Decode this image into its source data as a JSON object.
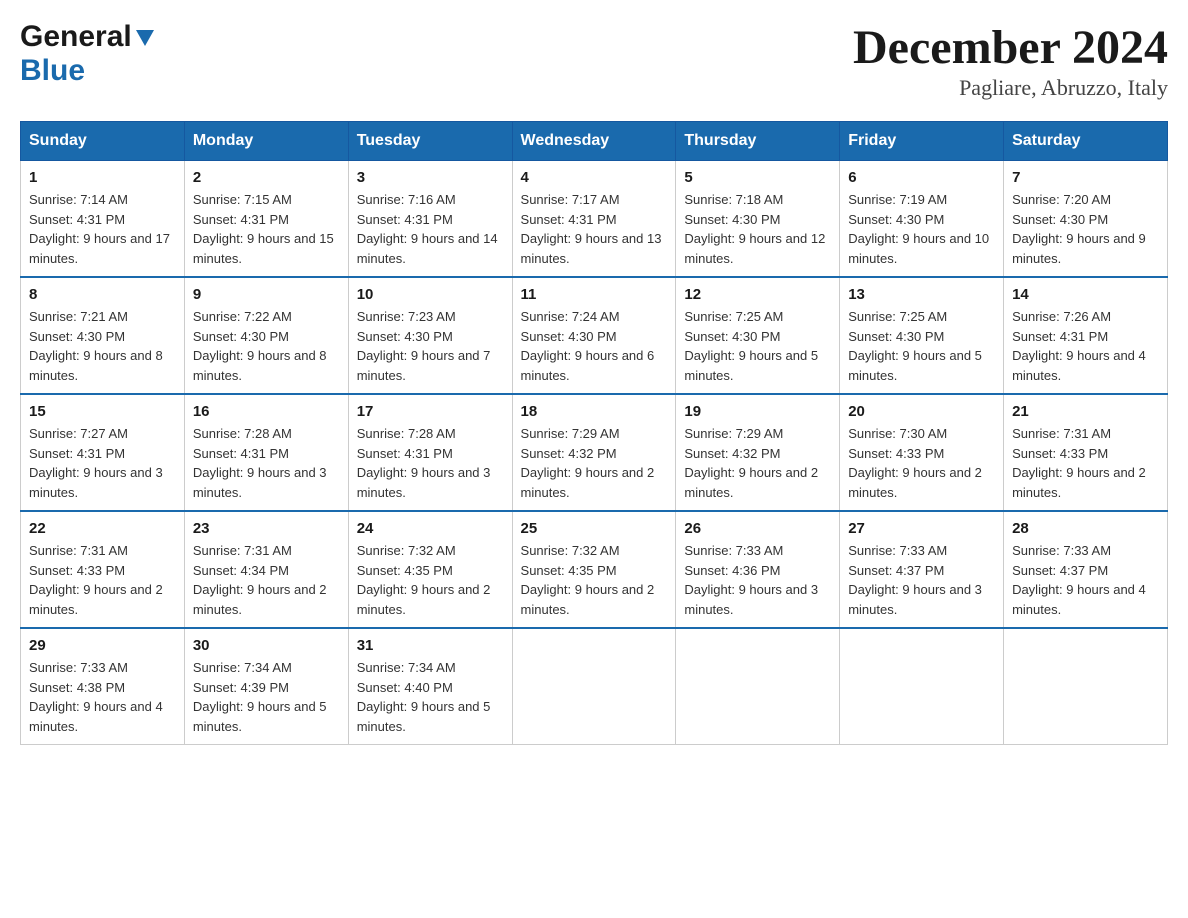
{
  "logo": {
    "general": "General",
    "blue": "Blue"
  },
  "title": {
    "month": "December 2024",
    "location": "Pagliare, Abruzzo, Italy"
  },
  "days_header": [
    "Sunday",
    "Monday",
    "Tuesday",
    "Wednesday",
    "Thursday",
    "Friday",
    "Saturday"
  ],
  "weeks": [
    [
      {
        "day": "1",
        "sunrise": "7:14 AM",
        "sunset": "4:31 PM",
        "daylight": "9 hours and 17 minutes."
      },
      {
        "day": "2",
        "sunrise": "7:15 AM",
        "sunset": "4:31 PM",
        "daylight": "9 hours and 15 minutes."
      },
      {
        "day": "3",
        "sunrise": "7:16 AM",
        "sunset": "4:31 PM",
        "daylight": "9 hours and 14 minutes."
      },
      {
        "day": "4",
        "sunrise": "7:17 AM",
        "sunset": "4:31 PM",
        "daylight": "9 hours and 13 minutes."
      },
      {
        "day": "5",
        "sunrise": "7:18 AM",
        "sunset": "4:30 PM",
        "daylight": "9 hours and 12 minutes."
      },
      {
        "day": "6",
        "sunrise": "7:19 AM",
        "sunset": "4:30 PM",
        "daylight": "9 hours and 10 minutes."
      },
      {
        "day": "7",
        "sunrise": "7:20 AM",
        "sunset": "4:30 PM",
        "daylight": "9 hours and 9 minutes."
      }
    ],
    [
      {
        "day": "8",
        "sunrise": "7:21 AM",
        "sunset": "4:30 PM",
        "daylight": "9 hours and 8 minutes."
      },
      {
        "day": "9",
        "sunrise": "7:22 AM",
        "sunset": "4:30 PM",
        "daylight": "9 hours and 8 minutes."
      },
      {
        "day": "10",
        "sunrise": "7:23 AM",
        "sunset": "4:30 PM",
        "daylight": "9 hours and 7 minutes."
      },
      {
        "day": "11",
        "sunrise": "7:24 AM",
        "sunset": "4:30 PM",
        "daylight": "9 hours and 6 minutes."
      },
      {
        "day": "12",
        "sunrise": "7:25 AM",
        "sunset": "4:30 PM",
        "daylight": "9 hours and 5 minutes."
      },
      {
        "day": "13",
        "sunrise": "7:25 AM",
        "sunset": "4:30 PM",
        "daylight": "9 hours and 5 minutes."
      },
      {
        "day": "14",
        "sunrise": "7:26 AM",
        "sunset": "4:31 PM",
        "daylight": "9 hours and 4 minutes."
      }
    ],
    [
      {
        "day": "15",
        "sunrise": "7:27 AM",
        "sunset": "4:31 PM",
        "daylight": "9 hours and 3 minutes."
      },
      {
        "day": "16",
        "sunrise": "7:28 AM",
        "sunset": "4:31 PM",
        "daylight": "9 hours and 3 minutes."
      },
      {
        "day": "17",
        "sunrise": "7:28 AM",
        "sunset": "4:31 PM",
        "daylight": "9 hours and 3 minutes."
      },
      {
        "day": "18",
        "sunrise": "7:29 AM",
        "sunset": "4:32 PM",
        "daylight": "9 hours and 2 minutes."
      },
      {
        "day": "19",
        "sunrise": "7:29 AM",
        "sunset": "4:32 PM",
        "daylight": "9 hours and 2 minutes."
      },
      {
        "day": "20",
        "sunrise": "7:30 AM",
        "sunset": "4:33 PM",
        "daylight": "9 hours and 2 minutes."
      },
      {
        "day": "21",
        "sunrise": "7:31 AM",
        "sunset": "4:33 PM",
        "daylight": "9 hours and 2 minutes."
      }
    ],
    [
      {
        "day": "22",
        "sunrise": "7:31 AM",
        "sunset": "4:33 PM",
        "daylight": "9 hours and 2 minutes."
      },
      {
        "day": "23",
        "sunrise": "7:31 AM",
        "sunset": "4:34 PM",
        "daylight": "9 hours and 2 minutes."
      },
      {
        "day": "24",
        "sunrise": "7:32 AM",
        "sunset": "4:35 PM",
        "daylight": "9 hours and 2 minutes."
      },
      {
        "day": "25",
        "sunrise": "7:32 AM",
        "sunset": "4:35 PM",
        "daylight": "9 hours and 2 minutes."
      },
      {
        "day": "26",
        "sunrise": "7:33 AM",
        "sunset": "4:36 PM",
        "daylight": "9 hours and 3 minutes."
      },
      {
        "day": "27",
        "sunrise": "7:33 AM",
        "sunset": "4:37 PM",
        "daylight": "9 hours and 3 minutes."
      },
      {
        "day": "28",
        "sunrise": "7:33 AM",
        "sunset": "4:37 PM",
        "daylight": "9 hours and 4 minutes."
      }
    ],
    [
      {
        "day": "29",
        "sunrise": "7:33 AM",
        "sunset": "4:38 PM",
        "daylight": "9 hours and 4 minutes."
      },
      {
        "day": "30",
        "sunrise": "7:34 AM",
        "sunset": "4:39 PM",
        "daylight": "9 hours and 5 minutes."
      },
      {
        "day": "31",
        "sunrise": "7:34 AM",
        "sunset": "4:40 PM",
        "daylight": "9 hours and 5 minutes."
      },
      null,
      null,
      null,
      null
    ]
  ],
  "labels": {
    "sunrise": "Sunrise: ",
    "sunset": "Sunset: ",
    "daylight": "Daylight: "
  }
}
